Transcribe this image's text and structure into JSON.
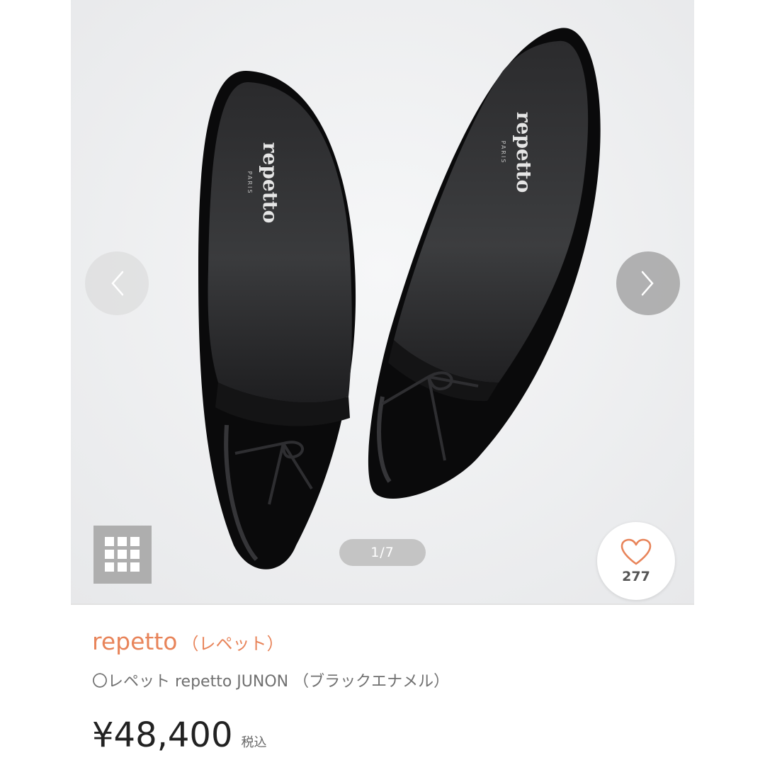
{
  "gallery": {
    "page_indicator": "1/7",
    "like_count": "277",
    "insole_logo_text": "repetto",
    "insole_logo_sub": "PARIS"
  },
  "product": {
    "brand": "repetto",
    "brand_kana": "（レペット）",
    "name": "〇レペット repetto JUNON （ブラックエナメル）",
    "price": "¥48,400",
    "tax_label": "税込"
  },
  "colors": {
    "accent": "#e8845a",
    "gallery_bg": "#eeeff0",
    "heart": "#e8845a"
  },
  "icons": [
    "chevron-left-icon",
    "chevron-right-icon",
    "grid-icon",
    "heart-icon"
  ]
}
